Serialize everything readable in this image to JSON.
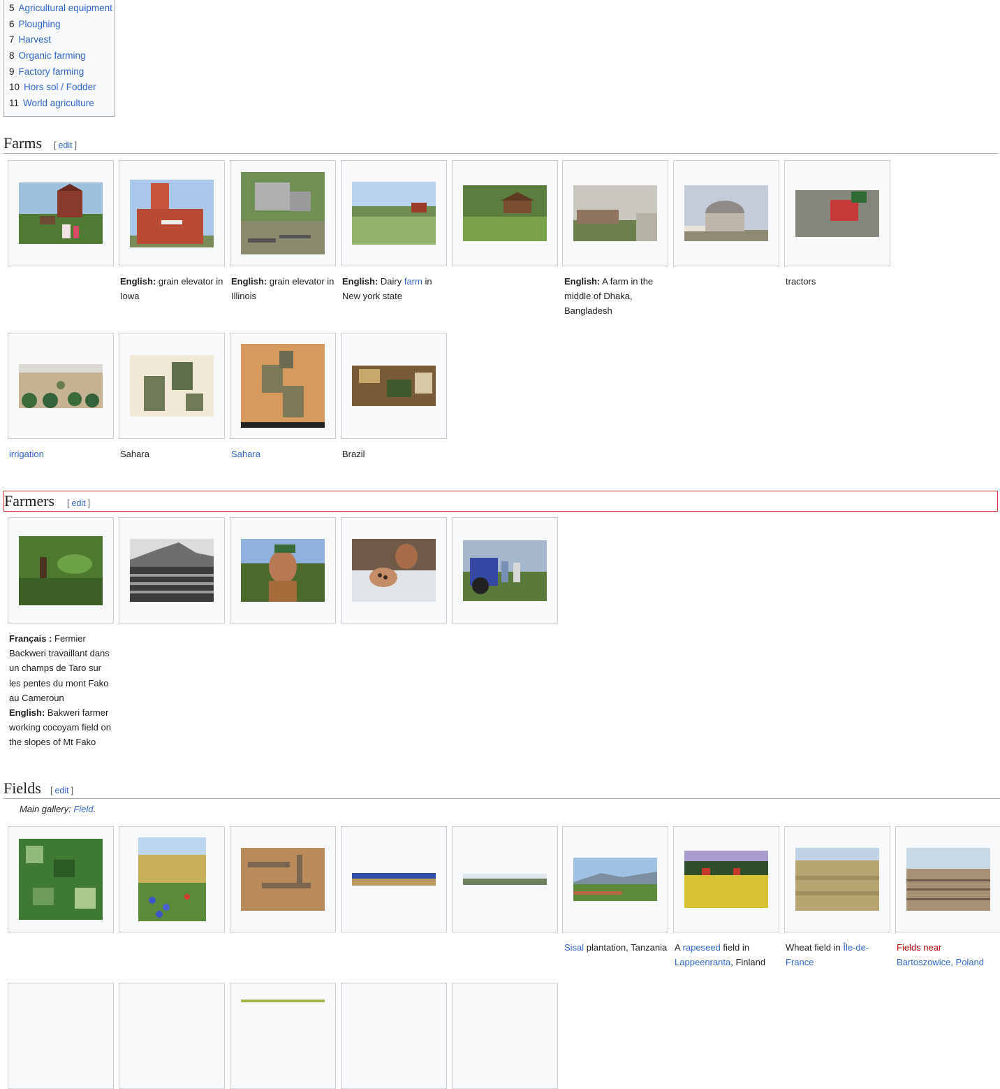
{
  "toc": {
    "items": [
      {
        "num": "5",
        "label": "Agricultural equipment"
      },
      {
        "num": "6",
        "label": "Ploughing"
      },
      {
        "num": "7",
        "label": "Harvest"
      },
      {
        "num": "8",
        "label": "Organic farming"
      },
      {
        "num": "9",
        "label": "Factory farming"
      },
      {
        "num": "10",
        "label": "Hors sol / Fodder"
      },
      {
        "num": "11",
        "label": "World agriculture"
      }
    ]
  },
  "edit_label": "edit",
  "sections": {
    "farms": {
      "title": "Farms"
    },
    "farmers": {
      "title": "Farmers"
    },
    "fields": {
      "title": "Fields",
      "main_gallery_prefix": "Main gallery: ",
      "main_gallery_link": "Field",
      "main_gallery_suffix": "."
    }
  },
  "captions": {
    "farms": {
      "c1": {
        "lang": "English:",
        "text": " grain elevator in Iowa"
      },
      "c2": {
        "lang": "English:",
        "text": " grain elevator in Illinois"
      },
      "c3": {
        "lang": "English:",
        "pre": " Dairy ",
        "link": "farm",
        "post": " in New york state"
      },
      "c5": {
        "lang": "English:",
        "text": " A farm in the middle of Dhaka, Bangladesh"
      },
      "c7": "tractors",
      "c8": "irrigation",
      "c9": "Sahara",
      "c10": "Sahara",
      "c11": "Brazil"
    },
    "farmers": {
      "c0": {
        "lang_fr": "Français :",
        "text_fr": " Fermier Backweri travaillant dans un champs de Taro sur les pentes du mont Fako au Cameroun",
        "lang_en": "English:",
        "text_en": " Bakweri farmer working cocoyam field on the slopes of Mt Fako"
      }
    },
    "fields": {
      "c5": {
        "link": "Sisal",
        "text": " plantation, Tanzania"
      },
      "c6": {
        "pre": "A ",
        "link": "rapeseed",
        "mid": " field in ",
        "link2": "Lappeenranta",
        "post": ", Finland"
      },
      "c7": {
        "pre": "Wheat field in ",
        "link": "Île-de-France"
      },
      "c8": {
        "red": "Fields near",
        "link": "Bartoszowice, Poland"
      }
    }
  },
  "colors": {
    "link": "#3366cc",
    "redlink": "#ba0000",
    "border": "#c8ccd1",
    "box_bg": "#f8f9fa"
  }
}
